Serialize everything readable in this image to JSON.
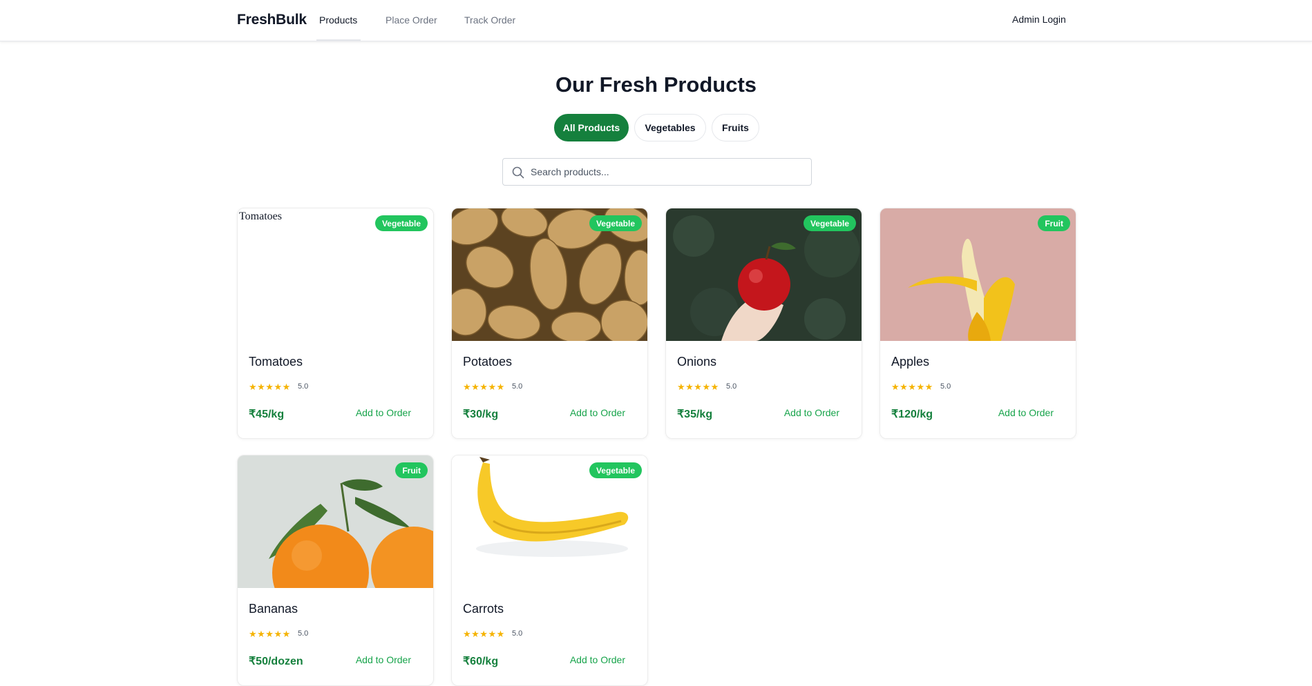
{
  "header": {
    "brand": "FreshBulk",
    "nav": [
      {
        "label": "Products",
        "active": true
      },
      {
        "label": "Place Order",
        "active": false
      },
      {
        "label": "Track Order",
        "active": false
      }
    ],
    "admin_login": "Admin Login"
  },
  "main": {
    "title": "Our Fresh Products",
    "filters": [
      {
        "label": "All Products",
        "active": true
      },
      {
        "label": "Vegetables",
        "active": false
      },
      {
        "label": "Fruits",
        "active": false
      }
    ],
    "search": {
      "placeholder": "Search products...",
      "value": ""
    },
    "products": [
      {
        "name": "Tomatoes",
        "category": "Vegetable",
        "stars": "★★★★★",
        "rating": "5.0",
        "price": "₹45/kg",
        "action": "Add to Order",
        "image": "broken",
        "image_alt": "Tomatoes"
      },
      {
        "name": "Potatoes",
        "category": "Vegetable",
        "stars": "★★★★★",
        "rating": "5.0",
        "price": "₹30/kg",
        "action": "Add to Order",
        "image": "potatoes"
      },
      {
        "name": "Onions",
        "category": "Vegetable",
        "stars": "★★★★★",
        "rating": "5.0",
        "price": "₹35/kg",
        "action": "Add to Order",
        "image": "red-apple-in-hand"
      },
      {
        "name": "Apples",
        "category": "Fruit",
        "stars": "★★★★★",
        "rating": "5.0",
        "price": "₹120/kg",
        "action": "Add to Order",
        "image": "peeled-banana-pink"
      },
      {
        "name": "Bananas",
        "category": "Fruit",
        "stars": "★★★★★",
        "rating": "5.0",
        "price": "₹50/dozen",
        "action": "Add to Order",
        "image": "oranges-with-leaves"
      },
      {
        "name": "Carrots",
        "category": "Vegetable",
        "stars": "★★★★★",
        "rating": "5.0",
        "price": "₹60/kg",
        "action": "Add to Order",
        "image": "banana-white"
      }
    ]
  },
  "colors": {
    "primary_green": "#15803d",
    "badge_green": "#22c55e",
    "star_yellow": "#f5b301"
  }
}
